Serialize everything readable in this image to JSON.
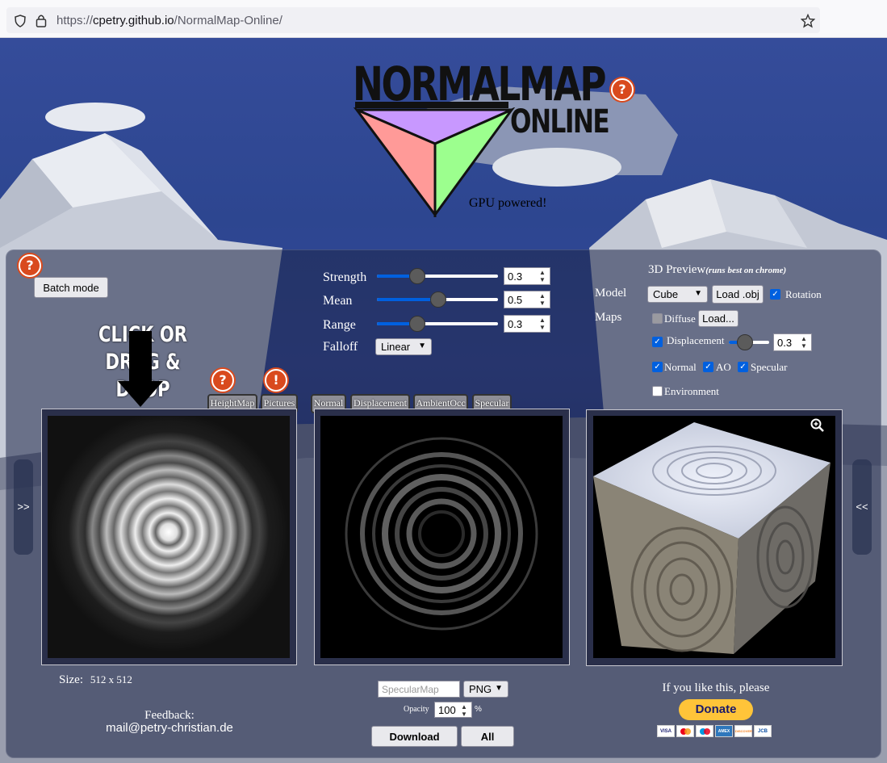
{
  "browser": {
    "url_prefix": "https://",
    "url_host": "cpetry.github.io",
    "url_path": "/NormalMap-Online/",
    "shield_icon": "shield-icon",
    "lock_icon": "lock-icon",
    "star_icon": "star-icon"
  },
  "logo": {
    "line1": "NORMALMAP",
    "line2": "ONLINE",
    "tagline": "GPU powered!",
    "colors": {
      "top": "#c898ff",
      "left": "#ff9a98",
      "right": "#9cff8e"
    }
  },
  "batch": {
    "label": "Batch mode"
  },
  "drop_hint": {
    "line1": "CLICK OR",
    "line2": "DRAG & DROP"
  },
  "settings": {
    "strength": {
      "label": "Strength",
      "value": "0.3",
      "fraction": 0.3
    },
    "mean": {
      "label": "Mean",
      "value": "0.5",
      "fraction": 0.5
    },
    "range": {
      "label": "Range",
      "value": "0.3",
      "fraction": 0.3
    },
    "falloff": {
      "label": "Falloff",
      "value": "Linear"
    }
  },
  "preview": {
    "title": "3D Preview",
    "note": "(runs best on chrome)",
    "model_label": "Model",
    "model_value": "Cube",
    "load_obj": "Load .obj",
    "rotation": "Rotation",
    "maps_label": "Maps",
    "diffuse": "Diffuse",
    "load": "Load...",
    "displacement": "Displacement",
    "displacement_value": "0.3",
    "displacement_fraction": 0.3,
    "normal": "Normal",
    "ao": "AO",
    "specular": "Specular",
    "environment": "Environment",
    "zoom_icon": "zoom-in-icon"
  },
  "tabs": {
    "left": [
      "HeightMap",
      "Pictures"
    ],
    "right": [
      "Normal",
      "Displacement",
      "AmbientOcc",
      "Specular"
    ]
  },
  "nav": {
    "left": ">>",
    "right": "<<"
  },
  "size": {
    "label": "Size:",
    "value": "512 x 512"
  },
  "feedback": {
    "label": "Feedback:",
    "email": "mail@petry-christian.de"
  },
  "export": {
    "filename_placeholder": "SpecularMap",
    "format": "PNG",
    "opacity_label": "Opacity",
    "opacity_value": "100",
    "percent": "%",
    "download": "Download",
    "all": "All"
  },
  "donate": {
    "text": "If you like this, please",
    "button": "Donate",
    "cards": [
      "VISA",
      "MC",
      "Maestro",
      "AMEX",
      "DISCOVER",
      "JCB"
    ]
  }
}
